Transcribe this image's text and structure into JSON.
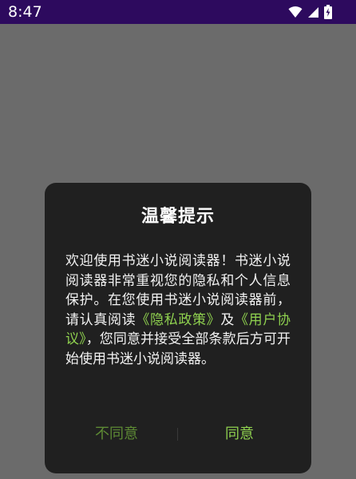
{
  "status_bar": {
    "time": "8:47",
    "icons": [
      "wifi-icon",
      "cellular-signal-icon",
      "battery-charging-icon"
    ]
  },
  "dialog": {
    "title": "温馨提示",
    "body": {
      "text_before": "欢迎使用书迷小说阅读器！书迷小说阅读器非常重视您的隐私和个人信息保护。在您使用书迷小说阅读器前，请认真阅读",
      "privacy_link": "《隐私政策》",
      "text_and": "及",
      "terms_link": "《用户协议》",
      "text_after": "，您同意并接受全部条款后方可开始使用书迷小说阅读器。"
    },
    "buttons": {
      "disagree": "不同意",
      "agree": "同意"
    }
  },
  "colors": {
    "status_bar": "#2d0a5e",
    "overlay": "#6b6b6b",
    "dialog_bg": "#202020",
    "link": "#8fd14f",
    "disagree_text": "#5d8a34"
  }
}
